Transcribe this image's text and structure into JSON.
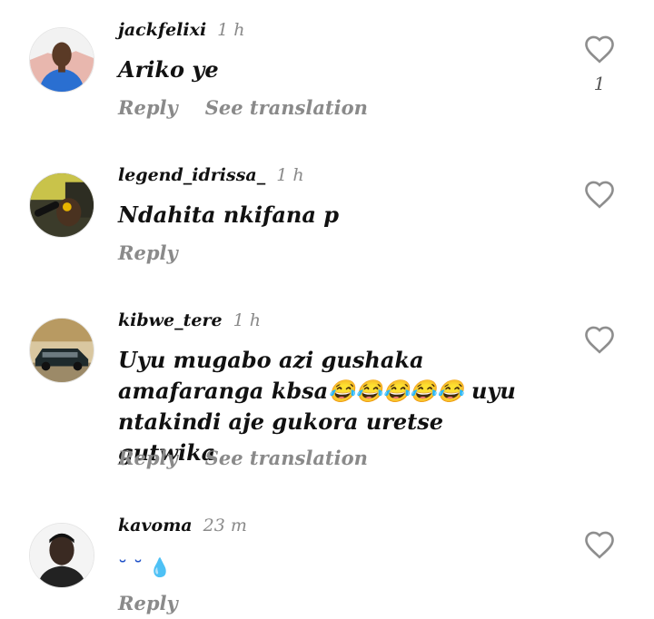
{
  "comments": [
    {
      "username": "jackfelixi",
      "time": "1 h",
      "text": "Ariko ye",
      "reply_label": "Reply",
      "translate_label": "See translation",
      "like_count": "1",
      "avatar_icon": "person-blue-shirt-avatar"
    },
    {
      "username": "legend_idrissa_",
      "time": "1 h",
      "text": "Ndahita nkifana p",
      "reply_label": "Reply",
      "avatar_icon": "person-microphone-avatar"
    },
    {
      "username": "kibwe_tere",
      "time": "1 h",
      "text": "Uyu mugabo azi gushaka amafaranga kbsa😂😂😂😂😂 uyu ntakindi aje gukora uretse gutwika",
      "reply_label": "Reply",
      "translate_label": "See translation",
      "avatar_icon": "vintage-car-avatar"
    },
    {
      "username": "kavoma",
      "time": "23 m",
      "text": "˘ ˘ 💧",
      "reply_label": "Reply",
      "avatar_icon": "person-portrait-avatar"
    }
  ],
  "icons": {
    "like": "heart-outline-icon"
  },
  "colors": {
    "muted": "#8a8a8a",
    "text": "#111111",
    "icon": "#8e8e8e"
  }
}
